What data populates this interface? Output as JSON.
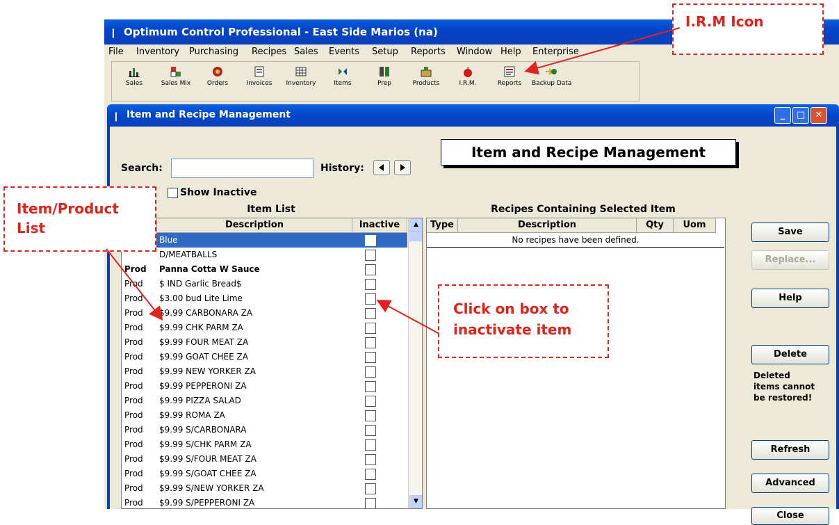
{
  "app_title": "Optimum Control Professional -  East Side Marios (na)",
  "menu": [
    "File",
    "Inventory",
    "Purchasing",
    "Recipes",
    "Sales",
    "Events",
    "Setup",
    "Reports",
    "Window",
    "Help",
    "Enterprise"
  ],
  "toolbar": [
    {
      "label": "Sales",
      "icon": "sales-chart-icon"
    },
    {
      "label": "Sales Mix",
      "icon": "sales-mix-icon"
    },
    {
      "label": "Orders",
      "icon": "orders-icon"
    },
    {
      "label": "Invoices",
      "icon": "invoices-icon"
    },
    {
      "label": "Inventory",
      "icon": "inventory-icon"
    },
    {
      "label": "Items",
      "icon": "items-icon"
    },
    {
      "label": "Prep",
      "icon": "prep-icon"
    },
    {
      "label": "Products",
      "icon": "products-icon"
    },
    {
      "label": "I.R.M.",
      "icon": "apple-icon"
    },
    {
      "label": "Reports",
      "icon": "reports-icon"
    },
    {
      "label": "Backup Data",
      "icon": "backup-icon"
    }
  ],
  "window": {
    "title": "Item and Recipe Management",
    "heading": "Item and Recipe Management",
    "search_label": "Search:",
    "search_value": "",
    "history_label": "History:",
    "show_inactive_label": "Show Inactive",
    "item_list_title": "Item List",
    "item_columns": {
      "description": "Description",
      "inactive": "Inactive"
    },
    "items": [
      {
        "type": "",
        "description": "Blue",
        "selected": true
      },
      {
        "type": "",
        "description": "D/MEATBALLS"
      },
      {
        "type": "Prod",
        "description": "Panna Cotta W Sauce",
        "bold": true
      },
      {
        "type": "Prod",
        "description": "$ IND Garlic Bread$"
      },
      {
        "type": "Prod",
        "description": "$3.00 bud Lite Lime"
      },
      {
        "type": "Prod",
        "description": "$9.99 CARBONARA ZA"
      },
      {
        "type": "Prod",
        "description": "$9.99 CHK PARM ZA"
      },
      {
        "type": "Prod",
        "description": "$9.99 FOUR MEAT ZA"
      },
      {
        "type": "Prod",
        "description": "$9.99 GOAT CHEE ZA"
      },
      {
        "type": "Prod",
        "description": "$9.99 NEW YORKER ZA"
      },
      {
        "type": "Prod",
        "description": "$9.99 PEPPERONI ZA"
      },
      {
        "type": "Prod",
        "description": "$9.99 PIZZA SALAD"
      },
      {
        "type": "Prod",
        "description": "$9.99 ROMA ZA"
      },
      {
        "type": "Prod",
        "description": "$9.99 S/CARBONARA"
      },
      {
        "type": "Prod",
        "description": "$9.99 S/CHK PARM ZA"
      },
      {
        "type": "Prod",
        "description": "$9.99 S/FOUR MEAT ZA"
      },
      {
        "type": "Prod",
        "description": "$9.99 S/GOAT CHEE ZA"
      },
      {
        "type": "Prod",
        "description": "$9.99 S/NEW YORKER ZA"
      },
      {
        "type": "Prod",
        "description": "$9.99 S/PEPPERONI ZA"
      }
    ],
    "recipes_title": "Recipes Containing Selected Item",
    "recipe_columns": {
      "type": "Type",
      "description": "Description",
      "qty": "Qty",
      "uom": "Uom"
    },
    "recipes_empty": "No recipes have been defined.",
    "buttons": {
      "save": "Save",
      "replace": "Replace...",
      "help": "Help",
      "delete": "Delete",
      "refresh": "Refresh",
      "advanced": "Advanced",
      "close": "Close"
    },
    "delete_note": [
      "Deleted",
      "items cannot",
      "be restored!"
    ]
  },
  "callouts": {
    "irm": "I.R.M Icon",
    "item_list": [
      "Item/Product",
      "List"
    ],
    "inactivate": [
      "Click on box to",
      "inactivate item"
    ]
  },
  "annotation_color": "#e3221b"
}
